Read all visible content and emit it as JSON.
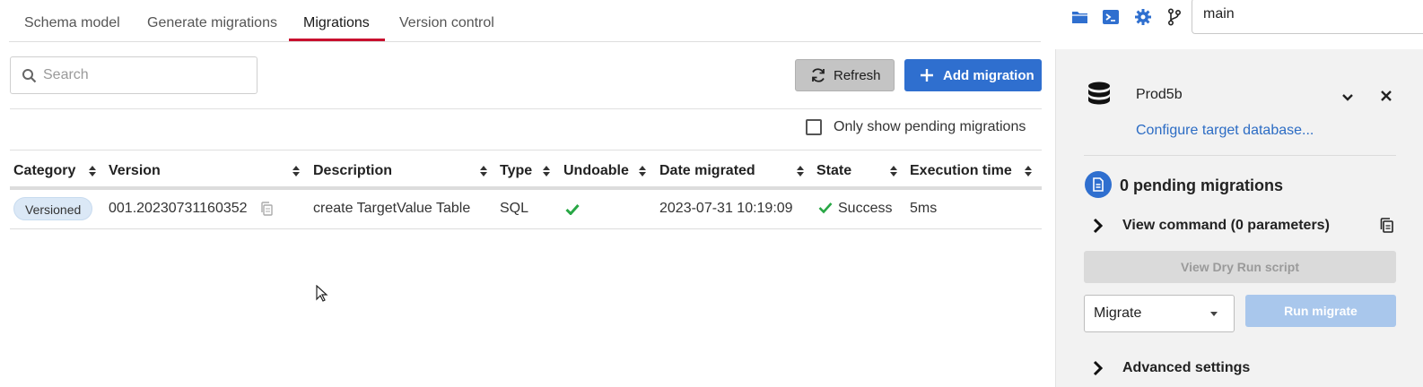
{
  "tabs": [
    {
      "label": "Schema model",
      "active": false
    },
    {
      "label": "Generate migrations",
      "active": false
    },
    {
      "label": "Migrations",
      "active": true
    },
    {
      "label": "Version control",
      "active": false
    }
  ],
  "accent_color": "#c8102e",
  "top_icons": [
    "folder-icon",
    "terminal-icon",
    "gear-icon",
    "git-branch-icon"
  ],
  "branch": {
    "value": "main"
  },
  "search": {
    "placeholder": "Search",
    "value": ""
  },
  "toolbar": {
    "refresh_label": "Refresh",
    "add_label": "Add migration"
  },
  "filter": {
    "pending_label": "Only show pending migrations",
    "checked": false
  },
  "table": {
    "columns": [
      "Category",
      "Version",
      "Description",
      "Type",
      "Undoable",
      "Date migrated",
      "State",
      "Execution time"
    ],
    "rows": [
      {
        "category": "Versioned",
        "version": "001.20230731160352",
        "description": "create TargetValue Table",
        "type": "SQL",
        "undoable": true,
        "date_migrated": "2023-07-31 10:19:09",
        "state": "Success",
        "execution_time": "5ms"
      }
    ]
  },
  "panel": {
    "database_name": "Prod5b",
    "configure_label": "Configure target database...",
    "pending_title": "0 pending migrations",
    "view_command_label": "View command (0 parameters)",
    "dry_run_label": "View Dry Run script",
    "migrate_select_value": "Migrate",
    "run_migrate_label": "Run migrate",
    "advanced_label": "Advanced settings"
  }
}
